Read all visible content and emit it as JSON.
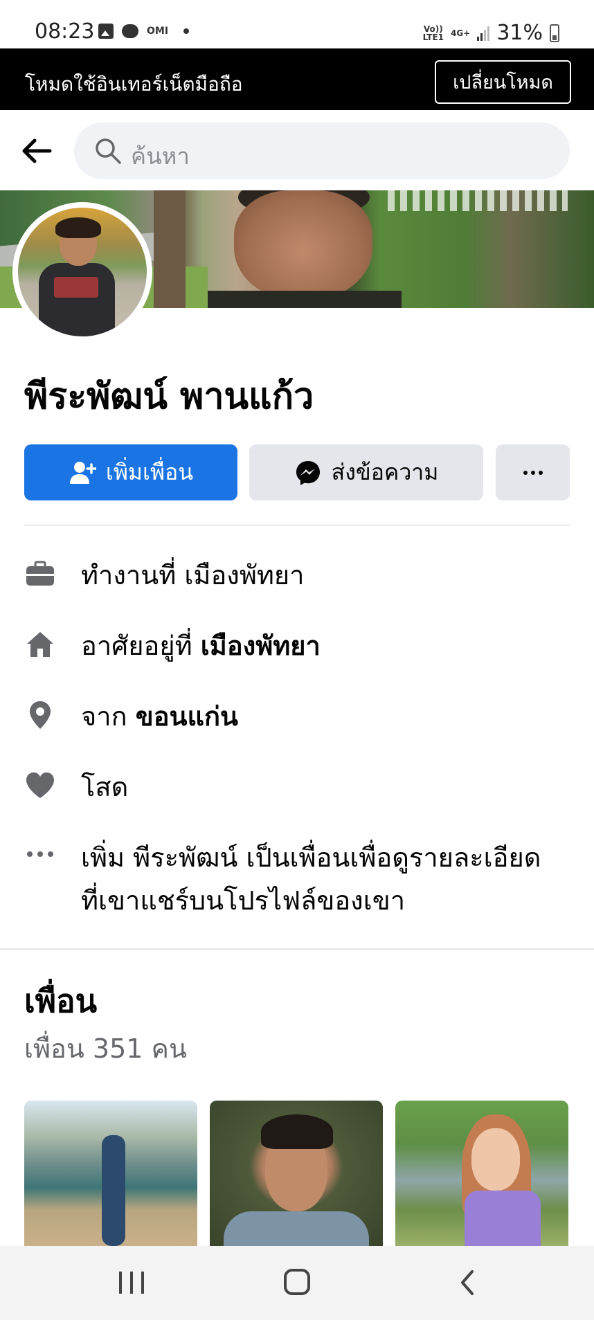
{
  "status_bar": {
    "time": "08:23",
    "omi": "OMI",
    "network_top": "Vo))",
    "network_bottom": "LTE1",
    "data_type": "4G+",
    "battery": "31%"
  },
  "mode_banner": {
    "text": "โหมดใช้อินเทอร์เน็ตมือถือ",
    "button": "เปลี่ยนโหมด"
  },
  "search": {
    "placeholder": "ค้นหา"
  },
  "profile": {
    "name": "พีระพัฒน์ พานแก้ว"
  },
  "actions": {
    "add_friend": "เพิ่มเพื่อน",
    "message": "ส่งข้อความ"
  },
  "details": {
    "work": {
      "prefix": "ทำงานที่",
      "value": "เมืองพัทยา"
    },
    "lives": {
      "prefix": "อาศัยอยู่ที่",
      "value": "เมืองพัทยา"
    },
    "from": {
      "prefix": "จาก",
      "value": "ขอนแก่น"
    },
    "relationship": "โสด",
    "more_line1": "เพิ่ม พีระพัฒน์ เป็นเพื่อนเพื่อดูรายละเอียด",
    "more_line2": "ที่เขาแชร์บนโปรไฟล์ของเขา"
  },
  "friends": {
    "title": "เพื่อน",
    "count": "เพื่อน 351 คน"
  },
  "colors": {
    "primary": "#1b74e4",
    "secondary_button": "#e4e6eb",
    "muted_text": "#65676b"
  },
  "icons": [
    "back-arrow-icon",
    "search-icon",
    "add-friend-icon",
    "messenger-icon",
    "more-icon",
    "briefcase-icon",
    "home-icon",
    "location-pin-icon",
    "heart-icon",
    "ellipsis-icon"
  ]
}
